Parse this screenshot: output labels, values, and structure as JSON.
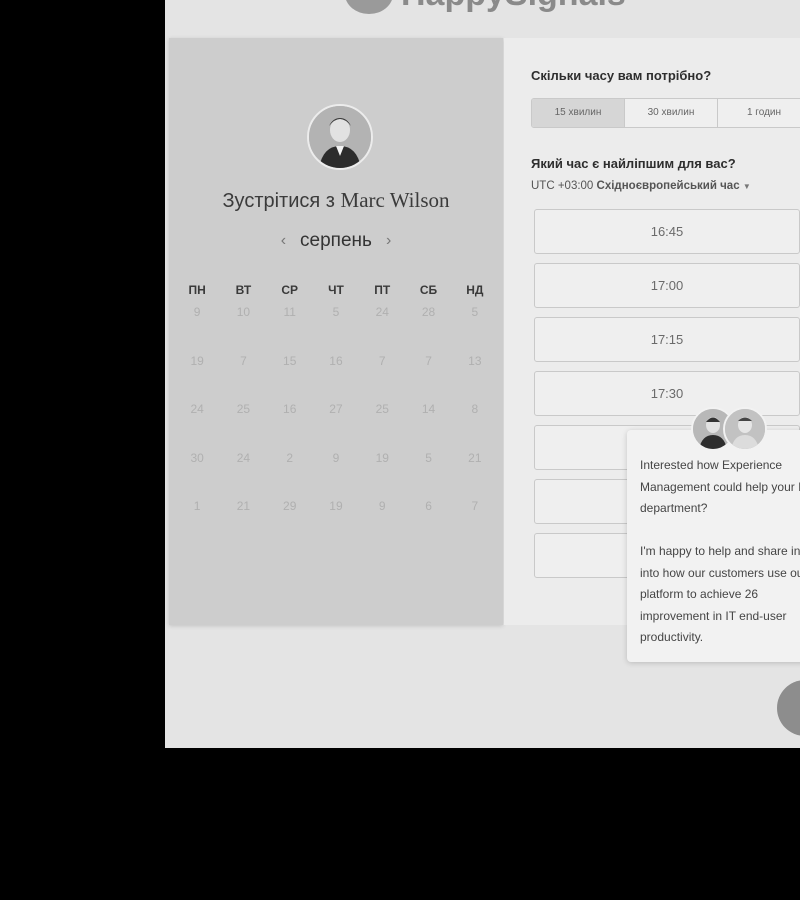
{
  "brand": {
    "logo_text": "HappySignals"
  },
  "host": {
    "prefix": "Зустрітися з",
    "name": "Marc Wilson"
  },
  "calendar": {
    "month": "серпень",
    "prev_icon": "chevron-left-icon",
    "next_icon": "chevron-right-icon",
    "weekdays": [
      "ПН",
      "ВТ",
      "СР",
      "ЧТ",
      "ПТ",
      "СБ",
      "НД"
    ],
    "weeks": [
      [
        "9",
        "10",
        "11",
        "5",
        "24",
        "28",
        "5"
      ],
      [
        "19",
        "7",
        "15",
        "16",
        "7",
        "7",
        "13"
      ],
      [
        "24",
        "25",
        "16",
        "27",
        "25",
        "14",
        "8"
      ],
      [
        "30",
        "24",
        "2",
        "9",
        "19",
        "5",
        "21"
      ],
      [
        "1",
        "21",
        "29",
        "19",
        "9",
        "6",
        "7"
      ]
    ]
  },
  "booking": {
    "duration_question": "Скільки часу вам потрібно?",
    "durations": [
      {
        "label": "15 хвилин",
        "selected": true
      },
      {
        "label": "30 хвилин",
        "selected": false
      },
      {
        "label": "1 годин",
        "selected": false
      }
    ],
    "time_question": "Який час є найліпшим для вас?",
    "timezone_offset": "UTC +03:00",
    "timezone_name": "Східноєвропейський час",
    "slots": [
      "16:45",
      "17:00",
      "17:15",
      "17:30",
      "",
      "",
      "",
      ""
    ]
  },
  "chat": {
    "message": "Interested how Experience Management could help your IT department?\n\nI'm happy to help and share insight into how our customers use our platform to achieve 26 improvement in IT end-user productivity."
  },
  "colors": {
    "page_bg": "#e4e4e4",
    "calendar_bg": "#cdcdcd",
    "form_bg": "#ececec",
    "outside": "#000000"
  }
}
